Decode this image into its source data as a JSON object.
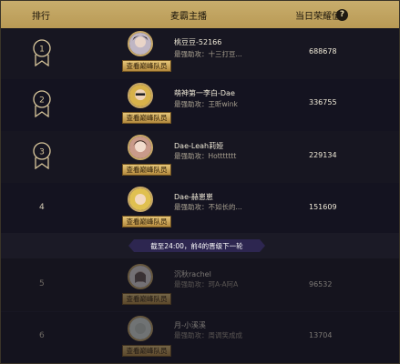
{
  "header": {
    "rank_label": "排行",
    "anchor_label": "麦霸主播",
    "value_label": "当日荣耀值",
    "help_icon": "?"
  },
  "rows": [
    {
      "rank": "1",
      "medal": true,
      "name": "桃豆豆-52166",
      "sub": "最强助攻：十三打豆...",
      "value": "688678",
      "button": "查看巅峰队员"
    },
    {
      "rank": "2",
      "medal": true,
      "name": "萌神第一李白-Dae",
      "sub": "最强助攻：王昕wink",
      "value": "336755",
      "button": "查看巅峰队员"
    },
    {
      "rank": "3",
      "medal": true,
      "name": "Dae-Leah莉娅",
      "sub": "最强助攻：Hottttttt",
      "value": "229134",
      "button": "查看巅峰队员"
    },
    {
      "rank": "4",
      "medal": false,
      "name": "Dae-赫崽崽",
      "sub": "最强助攻：不如长的...",
      "value": "151609",
      "button": "查看巅峰队员"
    },
    {
      "rank": "5",
      "medal": false,
      "name": "沉秋rachel",
      "sub": "最强助攻：珂A-A阿A",
      "value": "96532",
      "button": "查看巅峰队员"
    },
    {
      "rank": "6",
      "medal": false,
      "name": "月-小溪溪",
      "sub": "最强助攻：周调笑成成",
      "value": "13704",
      "button": "查看巅峰队员"
    }
  ],
  "notice": "截至24:00，前4的晋级下一轮"
}
